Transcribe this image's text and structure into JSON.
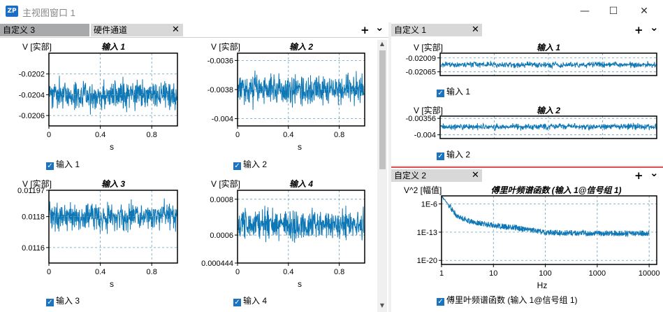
{
  "window": {
    "icon_text": "ZP",
    "title": "主视图窗口 1",
    "minimize_icon": "minimize-icon",
    "maximize_icon": "maximize-icon",
    "close_icon": "close-icon"
  },
  "left_pane": {
    "tabs": [
      {
        "label": "自定义 3",
        "state": "inactive"
      },
      {
        "label": "硬件通道",
        "state": "selected"
      }
    ],
    "close_glyph": "✕",
    "add_glyph": "+",
    "dropdown_glyph": "⌄",
    "plots": [
      {
        "id": "in1",
        "title": "输入 1",
        "ylabel": "V [实部]",
        "xlabel": "s",
        "yticks": [
          "-0.0202",
          "-0.0204",
          "-0.0206"
        ],
        "xticks": [
          "0",
          "0.4",
          "0.8"
        ],
        "legend": "输入 1",
        "seed": 11,
        "color": "#0e77b5"
      },
      {
        "id": "in2",
        "title": "输入 2",
        "ylabel": "V [实部]",
        "xlabel": "s",
        "yticks": [
          "-0.0036",
          "-0.0038",
          "-0.004"
        ],
        "xticks": [
          "0",
          "0.4",
          "0.8"
        ],
        "legend": "输入 2",
        "seed": 23,
        "color": "#0e77b5"
      },
      {
        "id": "in3",
        "title": "输入 3",
        "ylabel": "V [实部]",
        "xlabel": "s",
        "yticks": [
          "0.01197",
          "0.0118",
          "0.0116"
        ],
        "xticks": [
          "0",
          "0.4",
          "0.8"
        ],
        "legend": "输入 3",
        "seed": 37,
        "color": "#0e77b5"
      },
      {
        "id": "in4",
        "title": "输入 4",
        "ylabel": "V [实部]",
        "xlabel": "s",
        "yticks": [
          "0.0008",
          "0.0006",
          "0.000444"
        ],
        "xticks": [
          "0",
          "0.4",
          "0.8"
        ],
        "legend": "输入 4",
        "seed": 51,
        "color": "#0e77b5"
      }
    ]
  },
  "right_top_pane": {
    "tab": "自定义 1",
    "close_glyph": "✕",
    "add_glyph": "+",
    "dropdown_glyph": "⌄",
    "plots": [
      {
        "id": "r1",
        "title": "输入 1",
        "ylabel": "V [实部]",
        "yticks": [
          "-0.02009",
          "-0.02065"
        ],
        "legend": "输入 1",
        "seed": 63
      },
      {
        "id": "r2",
        "title": "输入 2",
        "ylabel": "V [实部]",
        "yticks": [
          "-0.00356",
          "-0.004"
        ],
        "legend": "输入 2",
        "seed": 77
      }
    ]
  },
  "right_bottom_pane": {
    "tab": "自定义 2",
    "close_glyph": "✕",
    "add_glyph": "+",
    "dropdown_glyph": "⌄",
    "plot": {
      "title": "傅里叶频谱函数 (输入 1@信号组 1)",
      "ylabel": "V^2 [幅值]",
      "xlabel": "Hz",
      "yticks": [
        "1E-6",
        "1E-13",
        "1E-20"
      ],
      "xticks": [
        "1",
        "10",
        "100",
        "1000",
        "10000"
      ],
      "legend": "傅里叶频谱函数 (输入 1@信号组 1)"
    }
  },
  "chart_data": [
    {
      "type": "line",
      "title": "输入 1",
      "ylabel": "V [实部]",
      "xlabel": "s",
      "xlim": [
        0,
        1
      ],
      "ylim": [
        -0.0207,
        -0.02
      ],
      "yticks": [
        -0.0202,
        -0.0204,
        -0.0206
      ],
      "xticks": [
        0,
        0.4,
        0.8
      ],
      "series": [
        {
          "name": "输入 1",
          "mean": -0.0204,
          "noise_band": [
            -0.0206,
            -0.0202
          ]
        }
      ],
      "grid": true
    },
    {
      "type": "line",
      "title": "输入 2",
      "ylabel": "V [实部]",
      "xlabel": "s",
      "xlim": [
        0,
        1
      ],
      "ylim": [
        -0.00405,
        -0.00355
      ],
      "yticks": [
        -0.0036,
        -0.0038,
        -0.004
      ],
      "xticks": [
        0,
        0.4,
        0.8
      ],
      "series": [
        {
          "name": "输入 2",
          "mean": -0.0038,
          "noise_band": [
            -0.00395,
            -0.00365
          ]
        }
      ],
      "grid": true
    },
    {
      "type": "line",
      "title": "输入 3",
      "ylabel": "V [实部]",
      "xlabel": "s",
      "xlim": [
        0,
        1
      ],
      "ylim": [
        0.0115,
        0.01197
      ],
      "yticks": [
        0.01197,
        0.0118,
        0.0116
      ],
      "xticks": [
        0,
        0.4,
        0.8
      ],
      "series": [
        {
          "name": "输入 3",
          "mean": 0.0118,
          "noise_band": [
            0.01165,
            0.01193
          ]
        }
      ],
      "grid": true
    },
    {
      "type": "line",
      "title": "输入 4",
      "ylabel": "V [实部]",
      "xlabel": "s",
      "xlim": [
        0,
        1
      ],
      "ylim": [
        0.000444,
        0.00085
      ],
      "yticks": [
        0.0008,
        0.0006,
        0.000444
      ],
      "xticks": [
        0,
        0.4,
        0.8
      ],
      "series": [
        {
          "name": "输入 4",
          "mean": 0.00066,
          "noise_band": [
            0.00054,
            0.00078
          ]
        }
      ],
      "grid": true
    },
    {
      "type": "line",
      "title": "输入 1",
      "ylabel": "V [实部]",
      "ylim": [
        -0.0208,
        -0.0199
      ],
      "yticks": [
        -0.02009,
        -0.02065
      ],
      "series": [
        {
          "name": "输入 1",
          "mean": -0.02037,
          "noise_band": [
            -0.02055,
            -0.0202
          ]
        }
      ],
      "grid": true
    },
    {
      "type": "line",
      "title": "输入 2",
      "ylabel": "V [实部]",
      "ylim": [
        -0.0041,
        -0.0035
      ],
      "yticks": [
        -0.00356,
        -0.004
      ],
      "series": [
        {
          "name": "输入 2",
          "mean": -0.00378,
          "noise_band": [
            -0.0039,
            -0.00366
          ]
        }
      ],
      "grid": true
    },
    {
      "type": "line",
      "title": "傅里叶频谱函数 (输入 1@信号组 1)",
      "ylabel": "V^2 [幅值]",
      "xlabel": "Hz",
      "xscale": "log",
      "yscale": "log",
      "xlim": [
        1,
        14000
      ],
      "yticks": [
        1e-06,
        1e-13,
        1e-20
      ],
      "xticks": [
        1,
        10,
        100,
        1000,
        10000
      ],
      "series": [
        {
          "name": "傅里叶频谱函数 (输入 1@信号组 1)",
          "x": [
            1,
            2,
            4,
            10,
            30,
            100,
            1000,
            10000
          ],
          "y": [
            0.0001,
            1e-09,
            3e-11,
            5e-12,
            1e-12,
            8e-14,
            5e-14,
            5e-14
          ]
        }
      ],
      "grid": true
    }
  ]
}
